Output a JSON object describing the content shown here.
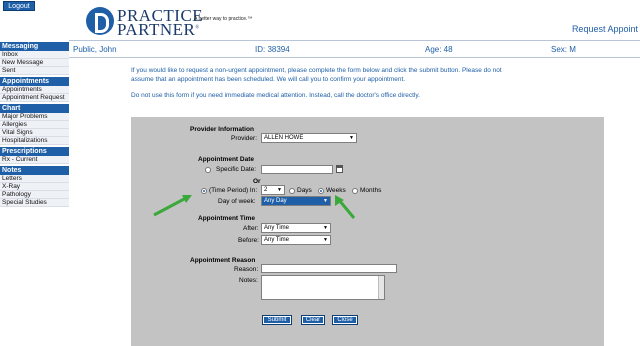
{
  "header": {
    "logout_label": "Logout",
    "logo_line1": "PRACTICE",
    "logo_line2": "PARTNER",
    "logo_reg": "®",
    "tagline": "A better way to practice.™",
    "page_title": "Request Appoint"
  },
  "sidebar": {
    "sections": [
      {
        "title": "Messaging",
        "items": [
          "Inbox",
          "New Message",
          "Sent"
        ]
      },
      {
        "title": "Appointments",
        "items": [
          "Appointments",
          "Appointment Request"
        ]
      },
      {
        "title": "Chart",
        "items": [
          "Major Problems",
          "Allergies",
          "Vital Signs",
          "Hospitalizations"
        ]
      },
      {
        "title": "Prescriptions",
        "items": [
          "Rx - Current"
        ]
      },
      {
        "title": "Notes",
        "items": [
          "Letters",
          "X-Ray",
          "Pathology",
          "Special Studies"
        ]
      }
    ]
  },
  "patient": {
    "name": "Public, John",
    "id": "ID: 38394",
    "age": "Age: 48",
    "sex": "Sex: M"
  },
  "intro": {
    "line1": "If you would like to request a non-urgent appointment, please complete the form below and click the submit button.  Please do not",
    "line2": "assume that an appointment has been scheduled.  We will call you to confirm your appointment.",
    "line3": "Do not use this form if you need immediate medical attention.  Instead, call the doctor's office directly."
  },
  "form": {
    "provider_section": "Provider Information",
    "provider_label": "Provider:",
    "provider_value": "ALLEN HOWE",
    "date_section": "Appointment Date",
    "specific_date_label": "Specific Date:",
    "specific_date_value": "",
    "or_label": "Or",
    "time_period_label": "(Time Period)  In:",
    "time_period_value": "2",
    "unit_days": "Days",
    "unit_weeks": "Weeks",
    "unit_months": "Months",
    "selected_unit": "Weeks",
    "dow_label": "Day of week:",
    "dow_value": "Any Day",
    "time_section": "Appointment Time",
    "after_label": "After:",
    "after_value": "Any Time",
    "before_label": "Before:",
    "before_value": "Any Time",
    "reason_section": "Appointment Reason",
    "reason_label": "Reason:",
    "reason_value": "",
    "notes_label": "Notes:",
    "notes_value": "",
    "submit_label": "Submit",
    "clear_label": "Clear",
    "close_label": "Close"
  },
  "colors": {
    "brand_blue": "#1f5fa8",
    "panel_gray": "#c3c3c3",
    "arrow_green": "#3aa83a"
  }
}
